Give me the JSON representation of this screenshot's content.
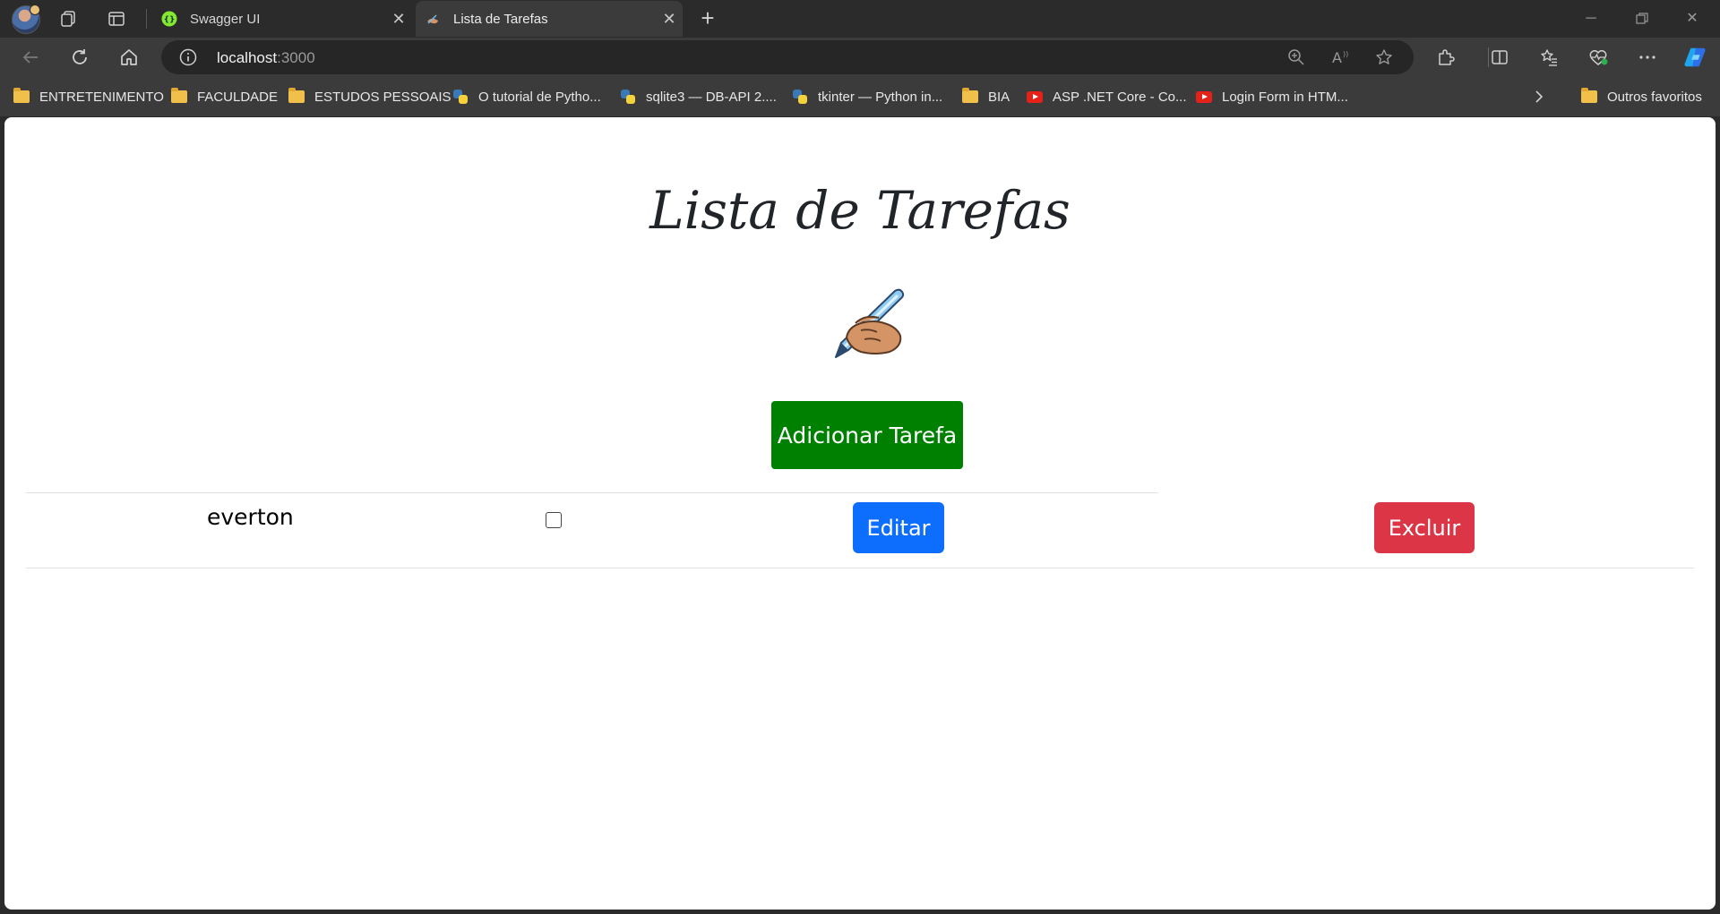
{
  "browser": {
    "tabs": [
      {
        "label": "Swagger UI",
        "favicon": "swagger-icon",
        "active": false
      },
      {
        "label": "Lista de Tarefas",
        "favicon": "writing-hand-icon",
        "active": true
      }
    ],
    "url": {
      "host": "localhost",
      "port": ":3000"
    },
    "bookmarks": [
      {
        "label": "ENTRETENIMENTO",
        "icon": "folder-icon"
      },
      {
        "label": "FACULDADE",
        "icon": "folder-icon"
      },
      {
        "label": "ESTUDOS PESSOAIS",
        "icon": "folder-icon"
      },
      {
        "label": "O tutorial de Pytho...",
        "icon": "python-icon"
      },
      {
        "label": "sqlite3 — DB-API 2....",
        "icon": "python-icon"
      },
      {
        "label": "tkinter — Python in...",
        "icon": "python-icon"
      },
      {
        "label": "BIA",
        "icon": "folder-icon"
      },
      {
        "label": "ASP .NET Core - Co...",
        "icon": "youtube-icon"
      },
      {
        "label": "Login Form in HTM...",
        "icon": "youtube-icon"
      }
    ],
    "other_favorites": "Outros favoritos"
  },
  "page": {
    "title": "Lista de Tarefas",
    "emoji": "✍️",
    "add_button": "Adicionar Tarefa",
    "tasks": [
      {
        "text": "everton",
        "done": false,
        "edit_label": "Editar",
        "delete_label": "Excluir"
      }
    ]
  },
  "colors": {
    "add": "#008000",
    "edit": "#0d6efd",
    "delete": "#dc3545"
  }
}
